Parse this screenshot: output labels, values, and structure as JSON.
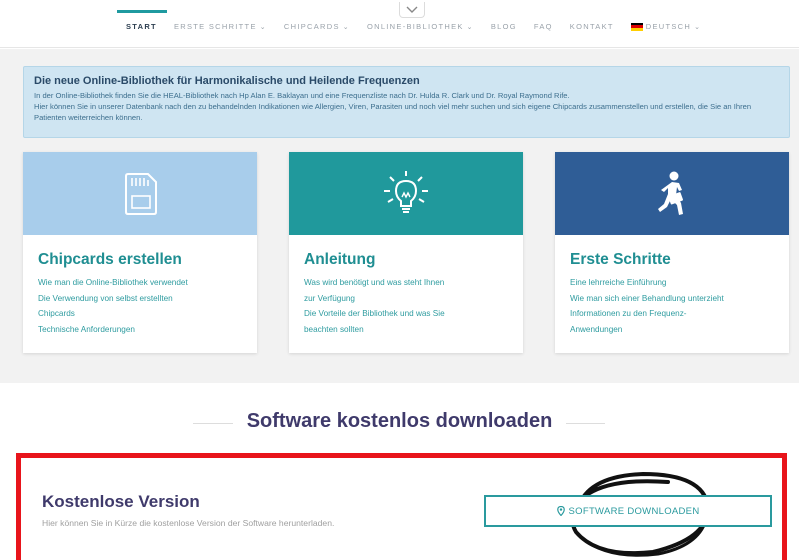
{
  "nav": {
    "items": [
      {
        "label": "START",
        "active": true,
        "dropdown": false
      },
      {
        "label": "ERSTE SCHRITTE",
        "active": false,
        "dropdown": true
      },
      {
        "label": "CHIPCARDS",
        "active": false,
        "dropdown": true
      },
      {
        "label": "ONLINE-BIBLIOTHEK",
        "active": false,
        "dropdown": true
      },
      {
        "label": "BLOG",
        "active": false,
        "dropdown": false
      },
      {
        "label": "FAQ",
        "active": false,
        "dropdown": false
      },
      {
        "label": "KONTAKT",
        "active": false,
        "dropdown": false
      }
    ],
    "language": {
      "label": "DEUTSCH",
      "flag": "flag-germany-icon",
      "chevron": "⌄"
    },
    "chevron": "⌄",
    "accent_color": "#1f9aa0"
  },
  "info": {
    "title": "Die neue Online-Bibliothek für Harmonikalische und Heilende Frequenzen",
    "line1": "In der Online-Bibliothek finden Sie die HEAL-Bibliothek nach Hp Alan E. Baklayan und eine Frequenzliste nach Dr. Hulda R. Clark und Dr. Royal Raymond Rife.",
    "line2": "Hier können Sie in unserer Datenbank nach den zu behandelnden Indikationen wie Allergien, Viren, Parasiten und noch viel mehr suchen und sich eigene Chipcards zusammenstellen und erstellen, die Sie an Ihren Patienten weiterreichen können."
  },
  "cards": [
    {
      "title": "Chipcards erstellen",
      "icon": "sd-card-icon",
      "color": "#a8cdeb",
      "lines": [
        "Wie man die Online-Bibliothek verwendet",
        "Die Verwendung von selbst erstellten",
        "Chipcards",
        "Technische Anforderungen"
      ]
    },
    {
      "title": "Anleitung",
      "icon": "lightbulb-icon",
      "color": "#20999c",
      "lines": [
        "Was wird benötigt und was steht Ihnen",
        "zur Verfügung",
        "Die Vorteile der Bibliothek und was Sie",
        "beachten sollten"
      ]
    },
    {
      "title": "Erste Schritte",
      "icon": "walking-businessman-icon",
      "color": "#2f5d96",
      "lines": [
        "Eine lehrreiche Einführung",
        "Wie man sich einer Behandlung unterzieht",
        "Informationen zu den Frequenz-",
        "Anwendungen"
      ]
    }
  ],
  "download": {
    "heading": "Software kostenlos downloaden",
    "title": "Kostenlose Version",
    "subtitle": "Hier können Sie in Kürze die kostenlose Version der Software herunterladen.",
    "button_label": "SOFTWARE DOWNLOADEN",
    "button_icon": "map-pin-icon",
    "highlight_color": "#e8141b"
  }
}
